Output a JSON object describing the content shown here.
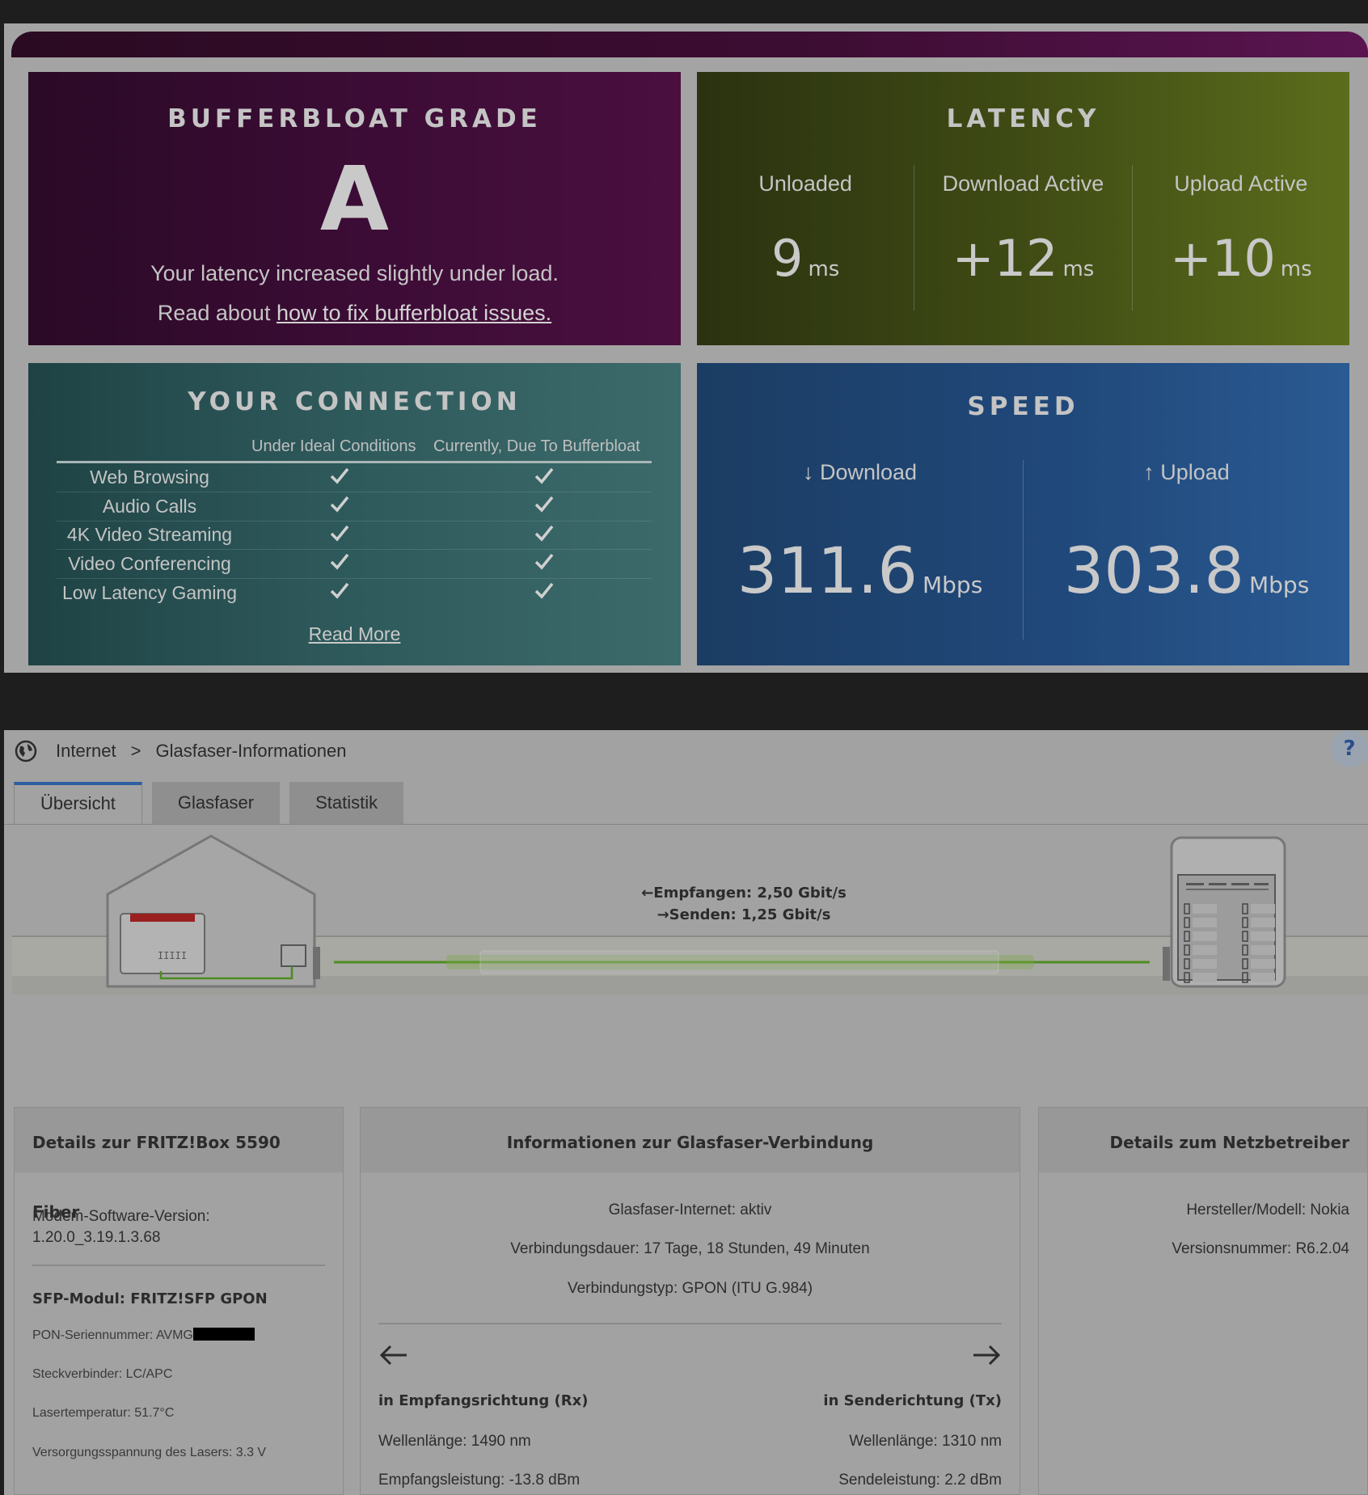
{
  "bufferbloat": {
    "grade_title": "BUFFERBLOAT GRADE",
    "grade": "A",
    "description": "Your latency increased slightly under load.",
    "read_prefix": "Read about ",
    "read_link": "how to fix bufferbloat issues.",
    "latency": {
      "title": "LATENCY",
      "items": [
        {
          "label": "Unloaded",
          "value": "9",
          "unit": "ms"
        },
        {
          "label": "Download Active",
          "value": "+12",
          "unit": "ms"
        },
        {
          "label": "Upload Active",
          "value": "+10",
          "unit": "ms"
        }
      ]
    },
    "connection": {
      "title": "YOUR CONNECTION",
      "col_ideal": "Under Ideal Conditions",
      "col_current": "Currently, Due To Bufferbloat",
      "rows": [
        {
          "name": "Web Browsing",
          "ideal": true,
          "current": true
        },
        {
          "name": "Audio Calls",
          "ideal": true,
          "current": true
        },
        {
          "name": "4K Video Streaming",
          "ideal": true,
          "current": true
        },
        {
          "name": "Video Conferencing",
          "ideal": true,
          "current": true
        },
        {
          "name": "Low Latency Gaming",
          "ideal": true,
          "current": true
        }
      ],
      "read_more": "Read More"
    },
    "speed": {
      "title": "SPEED",
      "download_label": "↓ Download",
      "download_value": "311.6",
      "upload_label": "↑ Upload",
      "upload_value": "303.8",
      "unit": "Mbps"
    }
  },
  "fritzbox": {
    "breadcrumb": {
      "root": "Internet",
      "separator": ">",
      "page": "Glasfaser-Informationen"
    },
    "help": "?",
    "tabs": [
      "Übersicht",
      "Glasfaser",
      "Statistik"
    ],
    "diagram": {
      "receive": "←Empfangen: 2,50 Gbit/s",
      "send": "→Senden: 1,25 Gbit/s"
    },
    "details_box": {
      "title": "Details zur FRITZ!Box 5590 Fiber",
      "modem_label": "Modem-Software-Version:",
      "modem_value": "1.20.0_3.19.1.3.68",
      "sfp_title": "SFP-Modul: FRITZ!SFP GPON",
      "pon_serial": "PON-Seriennummer: AVMG",
      "connector": "Steckverbinder: LC/APC",
      "laser_temp": "Lasertemperatur: 51.7°C",
      "laser_voltage": "Versorgungsspannung des Lasers: 3.3 V"
    },
    "fiber_info": {
      "title": "Informationen zur Glasfaser-Verbindung",
      "status": "Glasfaser-Internet: aktiv",
      "duration": "Verbindungsdauer: 17 Tage, 18 Stunden, 49 Minuten",
      "type": "Verbindungstyp: GPON (ITU G.984)",
      "rx_title": "in Empfangsrichtung (Rx)",
      "tx_title": "in Senderichtung (Tx)",
      "rx_wavelength": "Wellenlänge: 1490 nm",
      "tx_wavelength": "Wellenlänge: 1310 nm",
      "rx_power": "Empfangsleistung: -13.8 dBm",
      "tx_power": "Sendeleistung: 2.2 dBm"
    },
    "operator": {
      "title": "Details zum Netzbetreiber",
      "manufacturer": "Hersteller/Modell: Nokia",
      "version": "Versionsnummer: R6.2.04"
    }
  }
}
